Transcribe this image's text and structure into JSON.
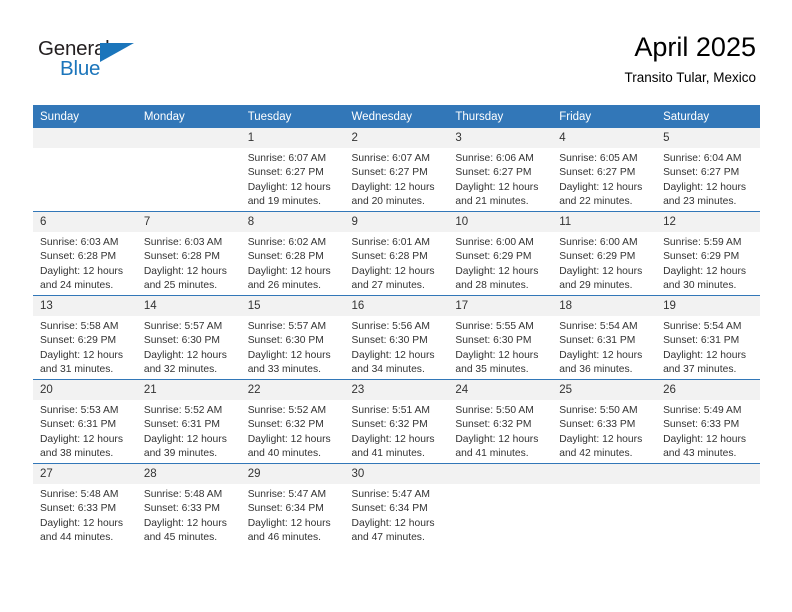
{
  "brand": {
    "name_part1": "General",
    "name_part2": "Blue",
    "accent_color": "#1b75bb",
    "triangle_icon": "triangle-icon"
  },
  "header": {
    "title": "April 2025",
    "subtitle": "Transito Tular, Mexico",
    "header_bg_color": "#3277b8"
  },
  "calendar": {
    "weekday_headers": [
      "Sunday",
      "Monday",
      "Tuesday",
      "Wednesday",
      "Thursday",
      "Friday",
      "Saturday"
    ],
    "weeks": [
      [
        {
          "day": "",
          "sunrise": "",
          "sunset": "",
          "daylight_line1": "",
          "daylight_line2": "",
          "empty": true
        },
        {
          "day": "",
          "sunrise": "",
          "sunset": "",
          "daylight_line1": "",
          "daylight_line2": "",
          "empty": true
        },
        {
          "day": "1",
          "sunrise": "Sunrise: 6:07 AM",
          "sunset": "Sunset: 6:27 PM",
          "daylight_line1": "Daylight: 12 hours",
          "daylight_line2": "and 19 minutes.",
          "empty": false
        },
        {
          "day": "2",
          "sunrise": "Sunrise: 6:07 AM",
          "sunset": "Sunset: 6:27 PM",
          "daylight_line1": "Daylight: 12 hours",
          "daylight_line2": "and 20 minutes.",
          "empty": false
        },
        {
          "day": "3",
          "sunrise": "Sunrise: 6:06 AM",
          "sunset": "Sunset: 6:27 PM",
          "daylight_line1": "Daylight: 12 hours",
          "daylight_line2": "and 21 minutes.",
          "empty": false
        },
        {
          "day": "4",
          "sunrise": "Sunrise: 6:05 AM",
          "sunset": "Sunset: 6:27 PM",
          "daylight_line1": "Daylight: 12 hours",
          "daylight_line2": "and 22 minutes.",
          "empty": false
        },
        {
          "day": "5",
          "sunrise": "Sunrise: 6:04 AM",
          "sunset": "Sunset: 6:27 PM",
          "daylight_line1": "Daylight: 12 hours",
          "daylight_line2": "and 23 minutes.",
          "empty": false
        }
      ],
      [
        {
          "day": "6",
          "sunrise": "Sunrise: 6:03 AM",
          "sunset": "Sunset: 6:28 PM",
          "daylight_line1": "Daylight: 12 hours",
          "daylight_line2": "and 24 minutes.",
          "empty": false
        },
        {
          "day": "7",
          "sunrise": "Sunrise: 6:03 AM",
          "sunset": "Sunset: 6:28 PM",
          "daylight_line1": "Daylight: 12 hours",
          "daylight_line2": "and 25 minutes.",
          "empty": false
        },
        {
          "day": "8",
          "sunrise": "Sunrise: 6:02 AM",
          "sunset": "Sunset: 6:28 PM",
          "daylight_line1": "Daylight: 12 hours",
          "daylight_line2": "and 26 minutes.",
          "empty": false
        },
        {
          "day": "9",
          "sunrise": "Sunrise: 6:01 AM",
          "sunset": "Sunset: 6:28 PM",
          "daylight_line1": "Daylight: 12 hours",
          "daylight_line2": "and 27 minutes.",
          "empty": false
        },
        {
          "day": "10",
          "sunrise": "Sunrise: 6:00 AM",
          "sunset": "Sunset: 6:29 PM",
          "daylight_line1": "Daylight: 12 hours",
          "daylight_line2": "and 28 minutes.",
          "empty": false
        },
        {
          "day": "11",
          "sunrise": "Sunrise: 6:00 AM",
          "sunset": "Sunset: 6:29 PM",
          "daylight_line1": "Daylight: 12 hours",
          "daylight_line2": "and 29 minutes.",
          "empty": false
        },
        {
          "day": "12",
          "sunrise": "Sunrise: 5:59 AM",
          "sunset": "Sunset: 6:29 PM",
          "daylight_line1": "Daylight: 12 hours",
          "daylight_line2": "and 30 minutes.",
          "empty": false
        }
      ],
      [
        {
          "day": "13",
          "sunrise": "Sunrise: 5:58 AM",
          "sunset": "Sunset: 6:29 PM",
          "daylight_line1": "Daylight: 12 hours",
          "daylight_line2": "and 31 minutes.",
          "empty": false
        },
        {
          "day": "14",
          "sunrise": "Sunrise: 5:57 AM",
          "sunset": "Sunset: 6:30 PM",
          "daylight_line1": "Daylight: 12 hours",
          "daylight_line2": "and 32 minutes.",
          "empty": false
        },
        {
          "day": "15",
          "sunrise": "Sunrise: 5:57 AM",
          "sunset": "Sunset: 6:30 PM",
          "daylight_line1": "Daylight: 12 hours",
          "daylight_line2": "and 33 minutes.",
          "empty": false
        },
        {
          "day": "16",
          "sunrise": "Sunrise: 5:56 AM",
          "sunset": "Sunset: 6:30 PM",
          "daylight_line1": "Daylight: 12 hours",
          "daylight_line2": "and 34 minutes.",
          "empty": false
        },
        {
          "day": "17",
          "sunrise": "Sunrise: 5:55 AM",
          "sunset": "Sunset: 6:30 PM",
          "daylight_line1": "Daylight: 12 hours",
          "daylight_line2": "and 35 minutes.",
          "empty": false
        },
        {
          "day": "18",
          "sunrise": "Sunrise: 5:54 AM",
          "sunset": "Sunset: 6:31 PM",
          "daylight_line1": "Daylight: 12 hours",
          "daylight_line2": "and 36 minutes.",
          "empty": false
        },
        {
          "day": "19",
          "sunrise": "Sunrise: 5:54 AM",
          "sunset": "Sunset: 6:31 PM",
          "daylight_line1": "Daylight: 12 hours",
          "daylight_line2": "and 37 minutes.",
          "empty": false
        }
      ],
      [
        {
          "day": "20",
          "sunrise": "Sunrise: 5:53 AM",
          "sunset": "Sunset: 6:31 PM",
          "daylight_line1": "Daylight: 12 hours",
          "daylight_line2": "and 38 minutes.",
          "empty": false
        },
        {
          "day": "21",
          "sunrise": "Sunrise: 5:52 AM",
          "sunset": "Sunset: 6:31 PM",
          "daylight_line1": "Daylight: 12 hours",
          "daylight_line2": "and 39 minutes.",
          "empty": false
        },
        {
          "day": "22",
          "sunrise": "Sunrise: 5:52 AM",
          "sunset": "Sunset: 6:32 PM",
          "daylight_line1": "Daylight: 12 hours",
          "daylight_line2": "and 40 minutes.",
          "empty": false
        },
        {
          "day": "23",
          "sunrise": "Sunrise: 5:51 AM",
          "sunset": "Sunset: 6:32 PM",
          "daylight_line1": "Daylight: 12 hours",
          "daylight_line2": "and 41 minutes.",
          "empty": false
        },
        {
          "day": "24",
          "sunrise": "Sunrise: 5:50 AM",
          "sunset": "Sunset: 6:32 PM",
          "daylight_line1": "Daylight: 12 hours",
          "daylight_line2": "and 41 minutes.",
          "empty": false
        },
        {
          "day": "25",
          "sunrise": "Sunrise: 5:50 AM",
          "sunset": "Sunset: 6:33 PM",
          "daylight_line1": "Daylight: 12 hours",
          "daylight_line2": "and 42 minutes.",
          "empty": false
        },
        {
          "day": "26",
          "sunrise": "Sunrise: 5:49 AM",
          "sunset": "Sunset: 6:33 PM",
          "daylight_line1": "Daylight: 12 hours",
          "daylight_line2": "and 43 minutes.",
          "empty": false
        }
      ],
      [
        {
          "day": "27",
          "sunrise": "Sunrise: 5:48 AM",
          "sunset": "Sunset: 6:33 PM",
          "daylight_line1": "Daylight: 12 hours",
          "daylight_line2": "and 44 minutes.",
          "empty": false
        },
        {
          "day": "28",
          "sunrise": "Sunrise: 5:48 AM",
          "sunset": "Sunset: 6:33 PM",
          "daylight_line1": "Daylight: 12 hours",
          "daylight_line2": "and 45 minutes.",
          "empty": false
        },
        {
          "day": "29",
          "sunrise": "Sunrise: 5:47 AM",
          "sunset": "Sunset: 6:34 PM",
          "daylight_line1": "Daylight: 12 hours",
          "daylight_line2": "and 46 minutes.",
          "empty": false
        },
        {
          "day": "30",
          "sunrise": "Sunrise: 5:47 AM",
          "sunset": "Sunset: 6:34 PM",
          "daylight_line1": "Daylight: 12 hours",
          "daylight_line2": "and 47 minutes.",
          "empty": false
        },
        {
          "day": "",
          "sunrise": "",
          "sunset": "",
          "daylight_line1": "",
          "daylight_line2": "",
          "empty": true
        },
        {
          "day": "",
          "sunrise": "",
          "sunset": "",
          "daylight_line1": "",
          "daylight_line2": "",
          "empty": true
        },
        {
          "day": "",
          "sunrise": "",
          "sunset": "",
          "daylight_line1": "",
          "daylight_line2": "",
          "empty": true
        }
      ]
    ]
  }
}
